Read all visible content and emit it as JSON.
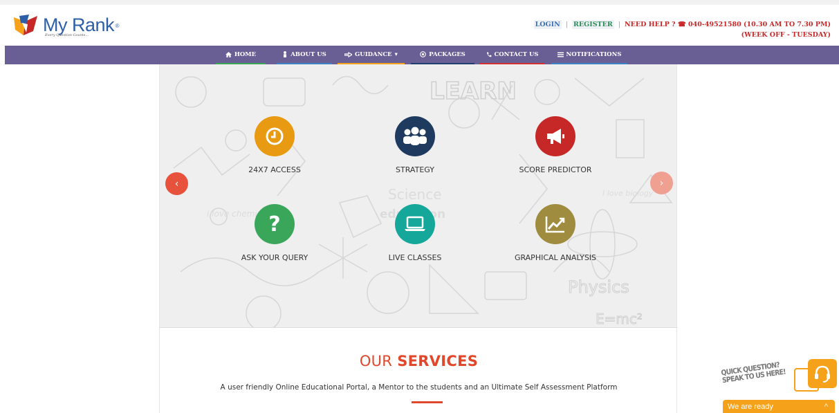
{
  "brand": {
    "name": "My Rank",
    "tagline": "Every Question Counts..."
  },
  "toplinks": {
    "login": "LOGIN",
    "register": "REGISTER",
    "help": "NEED HELP ? ☎ 040-49521580 (10.30 AM TO 7.30 PM)",
    "help_hours": "(WEEK OFF - TUESDAY)"
  },
  "nav": [
    {
      "label": "HOME",
      "icon": "home-icon",
      "underline": "#3aa655"
    },
    {
      "label": "ABOUT US",
      "icon": "person-icon",
      "underline": "#3b82c4"
    },
    {
      "label": "GUIDANCE",
      "icon": "hand-pointer-icon",
      "underline": "#f6a11a"
    },
    {
      "label": "PACKAGES",
      "icon": "target-icon",
      "underline": "#1f3f6e"
    },
    {
      "label": "CONTACT US",
      "icon": "phone-icon",
      "underline": "#d32f2f"
    },
    {
      "label": "NOTIFICATIONS",
      "icon": "list-icon",
      "underline": "#3b82c4"
    }
  ],
  "features": [
    {
      "label": "24X7 ACCESS",
      "icon": "clock-icon",
      "color": "#e89a12"
    },
    {
      "label": "STRATEGY",
      "icon": "users-icon",
      "color": "#1e3a5f"
    },
    {
      "label": "SCORE PREDICTOR",
      "icon": "megaphone-icon",
      "color": "#c62828"
    },
    {
      "label": "ASK YOUR QUERY",
      "icon": "question-icon",
      "color": "#3aa65a"
    },
    {
      "label": "LIVE CLASSES",
      "icon": "laptop-icon",
      "color": "#15a89a"
    },
    {
      "label": "GRAPHICAL ANALYSIS",
      "icon": "line-chart-icon",
      "color": "#a08c3e"
    }
  ],
  "doodle_words": [
    "LEARN",
    "Science",
    "education",
    "i love chemistry",
    "I love biology",
    "Physics",
    "E=mc²"
  ],
  "services": {
    "title_light": "OUR ",
    "title_bold": "SERVICES",
    "description": "A user friendly Online Educational Portal, a Mentor to the students and an Ultimate Self Assessment Platform"
  },
  "chat": {
    "prompt_line1": "QUICK QUESTION?",
    "prompt_line2": "SPEAK TO US HERE!",
    "ready": "We are ready",
    "toggle": "^"
  }
}
